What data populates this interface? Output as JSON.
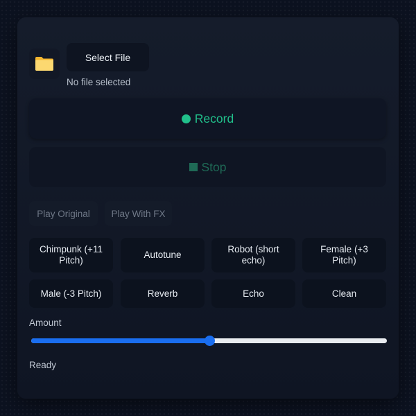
{
  "file": {
    "icon": "folder-icon",
    "select_label": "Select File",
    "status": "No file selected"
  },
  "record": {
    "label": "Record",
    "icon": "record-dot-icon",
    "color": "#21c08b"
  },
  "stop": {
    "label": "Stop",
    "icon": "stop-square-icon",
    "color": "#1f6a56"
  },
  "playback": {
    "original_label": "Play Original",
    "fx_label": "Play With FX"
  },
  "effects": [
    "Chimpunk (+11 Pitch)",
    "Autotune",
    "Robot (short echo)",
    "Female (+3 Pitch)",
    "Male (-3 Pitch)",
    "Reverb",
    "Echo",
    "Clean"
  ],
  "amount": {
    "label": "Amount",
    "value": 0.5,
    "accent": "#1a6ef0"
  },
  "status": "Ready"
}
